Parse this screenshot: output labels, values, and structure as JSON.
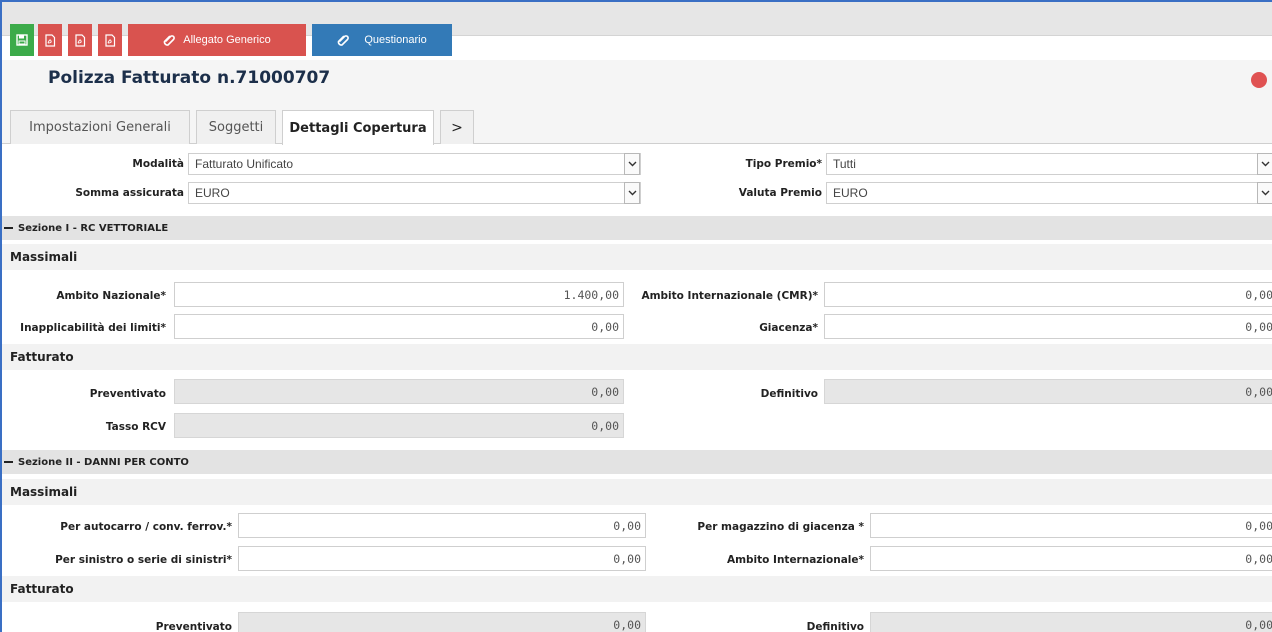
{
  "toolbar": {
    "allegato_label": "Allegato Generico",
    "questionario_label": "Questionario"
  },
  "page": {
    "title": "Polizza Fatturato n.71000707"
  },
  "tabs": [
    {
      "label": "Impostazioni Generali"
    },
    {
      "label": "Soggetti"
    },
    {
      "label": "Dettagli Copertura"
    },
    {
      "label": ">"
    }
  ],
  "general": {
    "modalita_label": "Modalità",
    "modalita_value": "Fatturato Unificato",
    "tipo_premio_label": "Tipo Premio*",
    "tipo_premio_value": "Tutti",
    "somma_label": "Somma assicurata",
    "somma_value": "EURO",
    "valuta_label": "Valuta Premio",
    "valuta_value": "EURO"
  },
  "sezione1": {
    "title": "Sezione I - RC VETTORIALE",
    "massimali_title": "Massimali",
    "ambito_naz_label": "Ambito Nazionale*",
    "ambito_naz_value": "1.400,00",
    "ambito_int_label": "Ambito Internazionale (CMR)*",
    "ambito_int_value": "0,00",
    "inappl_label": "Inapplicabilità dei limiti*",
    "inappl_value": "0,00",
    "giacenza_label": "Giacenza*",
    "giacenza_value": "0,00",
    "fatturato_title": "Fatturato",
    "preventivato_label": "Preventivato",
    "preventivato_value": "0,00",
    "definitivo_label": "Definitivo",
    "definitivo_value": "0,00",
    "tasso_label": "Tasso RCV",
    "tasso_value": "0,00"
  },
  "sezione2": {
    "title": "Sezione II - DANNI PER CONTO",
    "massimali_title": "Massimali",
    "autocarro_label": "Per autocarro / conv. ferrov.*",
    "autocarro_value": "0,00",
    "magazzino_label": "Per magazzino di giacenza *",
    "magazzino_value": "0,00",
    "sinistro_label": "Per sinistro o serie di sinistri*",
    "sinistro_value": "0,00",
    "ambito_int_label": "Ambito Internazionale*",
    "ambito_int_value": "0,00",
    "fatturato_title": "Fatturato",
    "preventivato_label": "Preventivato",
    "preventivato_value": "0,00",
    "definitivo_label": "Definitivo",
    "definitivo_value": "0,00"
  },
  "colors": {
    "save": "#3cab4a",
    "pdf": "#d9534f",
    "questionario": "#337ab7",
    "status_dot": "#e05252"
  }
}
